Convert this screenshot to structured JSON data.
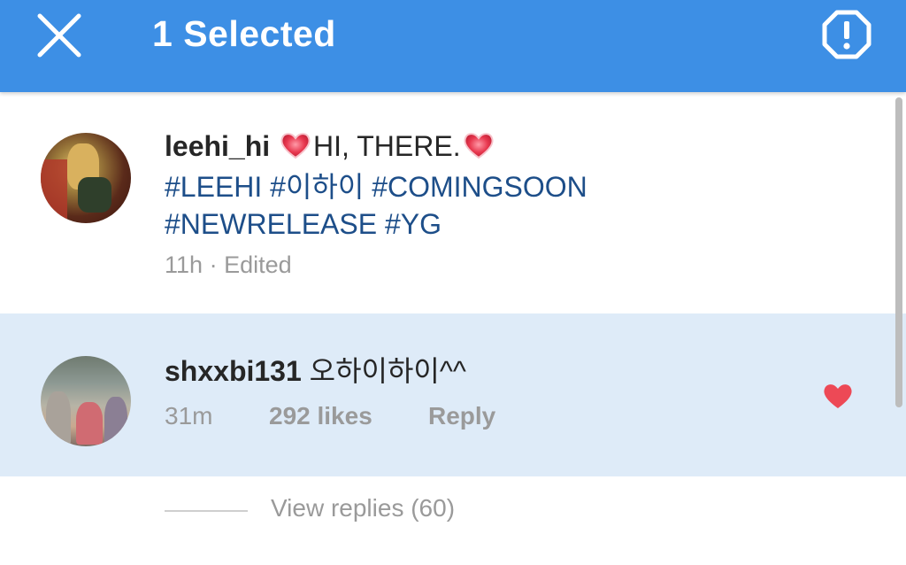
{
  "appbar": {
    "title": "1 Selected",
    "close_icon": "close-icon",
    "report_icon": "report-octagon-icon",
    "background": "#3d8fe5"
  },
  "caption": {
    "username": "leehi_hi",
    "text": "HI, THERE.",
    "emoji": "heart-emoji",
    "hashtags": [
      "#LEEHI",
      "#이하이",
      "#COMINGSOON",
      "#NEWRELEASE",
      "#YG"
    ],
    "time": "11h",
    "separator": "·",
    "edited": "Edited"
  },
  "comment": {
    "username": "shxxbi131",
    "text": "오하이하이^^",
    "time": "31m",
    "likes": "292 likes",
    "reply_label": "Reply",
    "liked": true,
    "like_color": "#ed4956",
    "selected_background": "#deebf8"
  },
  "replies": {
    "label": "View replies (60)"
  }
}
